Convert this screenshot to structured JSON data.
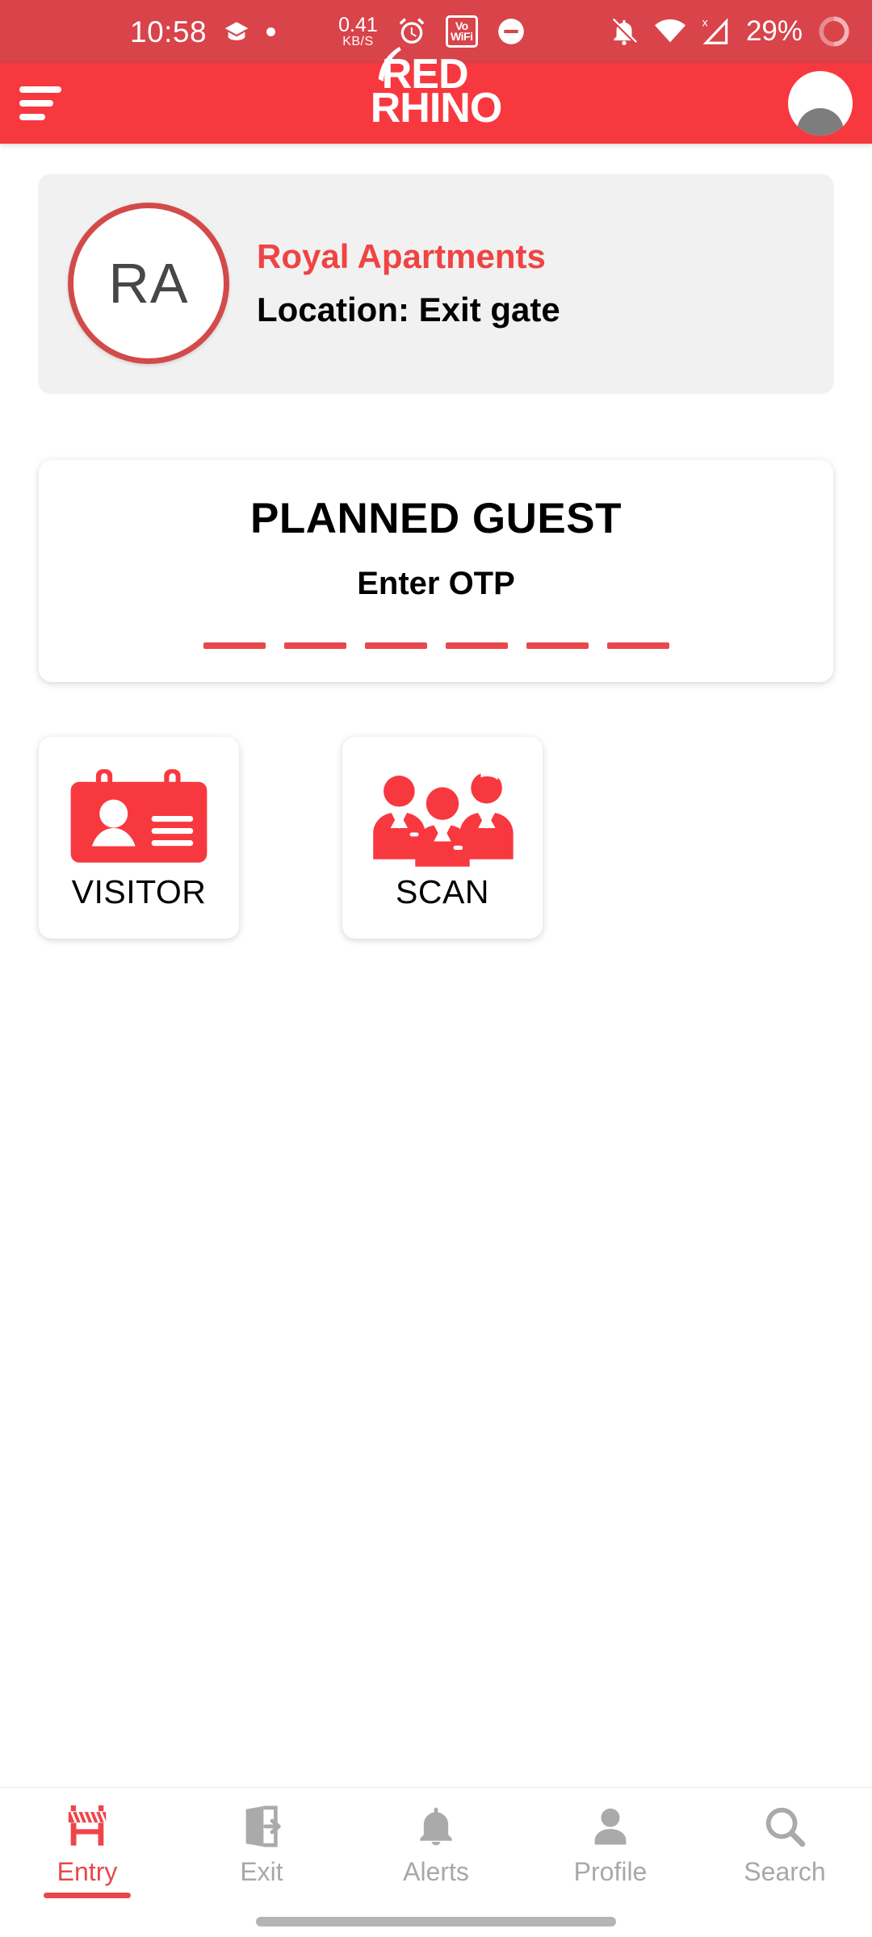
{
  "status_bar": {
    "time": "10:58",
    "network_speed_value": "0.41",
    "network_speed_unit": "KB/S",
    "battery_percent": "29%",
    "vowifi_top": "Vo",
    "vowifi_bottom": "WiFi",
    "icons": [
      "graduation-cap-icon",
      "dot-icon",
      "alarm-icon",
      "vowifi-icon",
      "dnd-icon",
      "bell-muted-icon",
      "wifi-icon",
      "no-sim-icon",
      "battery-icon"
    ],
    "background_color": "#d9434a"
  },
  "app_bar": {
    "menu_label": "menu",
    "logo_line1": "RED",
    "logo_line2": "RHINO",
    "background_color": "#f8383f"
  },
  "property_card": {
    "initials": "RA",
    "name": "Royal Apartments",
    "location": "Location: Exit gate",
    "name_color": "#ef4444"
  },
  "otp_card": {
    "title": "PLANNED GUEST",
    "subtitle": "Enter OTP",
    "digits": [
      "",
      "",
      "",
      "",
      "",
      ""
    ],
    "underline_color": "#e8484b"
  },
  "actions": [
    {
      "label": "VISITOR",
      "icon": "id-badge-icon"
    },
    {
      "label": "SCAN",
      "icon": "people-group-icon"
    }
  ],
  "bottom_nav": {
    "active_index": 0,
    "items": [
      {
        "label": "Entry",
        "icon": "barricade-icon"
      },
      {
        "label": "Exit",
        "icon": "door-exit-icon"
      },
      {
        "label": "Alerts",
        "icon": "bell-icon"
      },
      {
        "label": "Profile",
        "icon": "person-icon"
      },
      {
        "label": "Search",
        "icon": "search-icon"
      }
    ],
    "active_color": "#e8484b",
    "inactive_color": "#a8a8a8"
  }
}
